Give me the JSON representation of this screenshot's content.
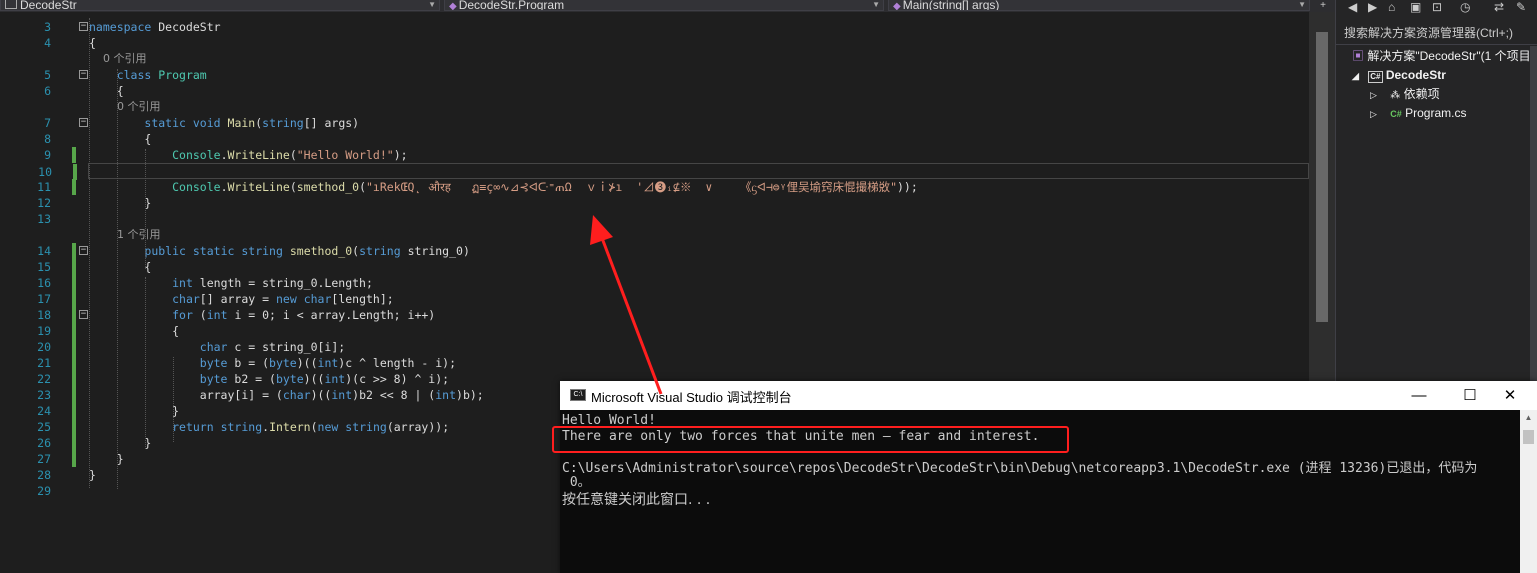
{
  "navbar": {
    "project": "DecodeStr",
    "class": "DecodeStr.Program",
    "member": "Main(string[] args)"
  },
  "editor": {
    "lines": [
      {
        "n": "3",
        "code": "namespace DecodeStr"
      },
      {
        "n": "4",
        "code": "{"
      },
      {
        "n": "",
        "code": "    0 个引用",
        "lens": true
      },
      {
        "n": "5",
        "code": "    class Program"
      },
      {
        "n": "6",
        "code": "    {"
      },
      {
        "n": "",
        "code": "        0 个引用",
        "lens": true
      },
      {
        "n": "7",
        "code": "        static void Main(string[] args)"
      },
      {
        "n": "8",
        "code": "        {"
      },
      {
        "n": "9",
        "code": "            Console.WriteLine(\"Hello World!\");"
      },
      {
        "n": "10",
        "code": ""
      },
      {
        "n": "11",
        "code": "            Console.WriteLine(smethod_0(\"ıRekŒQ˛ औरह   ฏ≡ç∞∿⊿⊰ᐊᑢ⁼ጠΩ  ｖｉ⊁ı  '⊿❸ᵢ⊈※  ∨    《ᦓᐊ⊣⊜ᵞ俚吴堬窍床惃撮梯敚\"));"
      },
      {
        "n": "12",
        "code": "        }"
      },
      {
        "n": "13",
        "code": ""
      },
      {
        "n": "",
        "code": "        1 个引用",
        "lens": true
      },
      {
        "n": "14",
        "code": "        public static string smethod_0(string string_0)"
      },
      {
        "n": "15",
        "code": "        {"
      },
      {
        "n": "16",
        "code": "            int length = string_0.Length;"
      },
      {
        "n": "17",
        "code": "            char[] array = new char[length];"
      },
      {
        "n": "18",
        "code": "            for (int i = 0; i < array.Length; i++)"
      },
      {
        "n": "19",
        "code": "            {"
      },
      {
        "n": "20",
        "code": "                char c = string_0[i];"
      },
      {
        "n": "21",
        "code": "                byte b = (byte)((int)c ^ length - i);"
      },
      {
        "n": "22",
        "code": "                byte b2 = (byte)((int)(c >> 8) ^ i);"
      },
      {
        "n": "23",
        "code": "                array[i] = (char)((int)b2 << 8 | (int)b);"
      },
      {
        "n": "24",
        "code": "            }"
      },
      {
        "n": "25",
        "code": "            return string.Intern(new string(array));"
      },
      {
        "n": "26",
        "code": "        }"
      },
      {
        "n": "27",
        "code": "    }"
      },
      {
        "n": "28",
        "code": "}"
      },
      {
        "n": "29",
        "code": ""
      }
    ]
  },
  "solution_explorer": {
    "search_placeholder": "搜索解决方案资源管理器(Ctrl+;)",
    "solution_label": "解决方案\"DecodeStr\"(1 个项目",
    "project_label": "DecodeStr",
    "deps_label": "依赖项",
    "file_label": "Program.cs",
    "cs_badge": "C#",
    "cs_file_badge": "C#"
  },
  "console": {
    "title": "Microsoft Visual Studio 调试控制台",
    "icon_text": "C:\\",
    "minimize": "—",
    "maximize": "☐",
    "close": "✕",
    "lines": [
      "Hello World!",
      "There are only two forces that unite men — fear and interest.",
      "",
      "C:\\Users\\Administrator\\source\\repos\\DecodeStr\\DecodeStr\\bin\\Debug\\netcoreapp3.1\\DecodeStr.exe (进程 13236)已退出，代码为",
      " 0。",
      "按任意键关闭此窗口. . ."
    ]
  },
  "colors": {
    "keyword": "#569cd6",
    "type": "#4ec9b0",
    "string": "#d69d85",
    "method": "#dcdcaa",
    "annotation": "#ff1e1e"
  }
}
